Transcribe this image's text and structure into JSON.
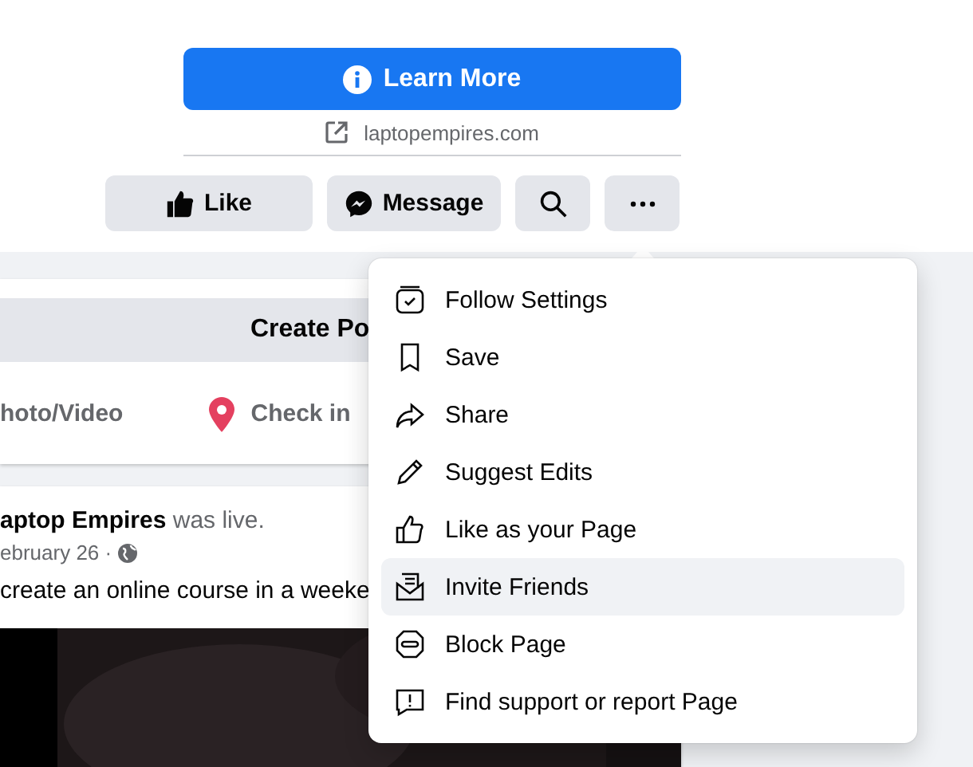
{
  "header": {
    "cta": {
      "label": "Learn More"
    },
    "website": "laptopempires.com"
  },
  "actions": [
    {
      "kind": "like",
      "label": "Like"
    },
    {
      "kind": "message",
      "label": "Message"
    },
    {
      "kind": "search"
    },
    {
      "kind": "more"
    }
  ],
  "create_post": {
    "title": "Create Po",
    "options": [
      {
        "label": "hoto/Video"
      },
      {
        "kind": "checkin",
        "label": "Check in"
      }
    ]
  },
  "post": {
    "author": "aptop Empires",
    "status": "was live.",
    "date": "ebruary 26 ·",
    "text": "create an online course in a weeke"
  },
  "menu": {
    "items": [
      {
        "label": "Follow Settings",
        "selected": false
      },
      {
        "label": "Save",
        "selected": false
      },
      {
        "label": "Share",
        "selected": false
      },
      {
        "label": "Suggest Edits",
        "selected": false
      },
      {
        "label": "Like as your Page",
        "selected": false
      },
      {
        "label": "Invite Friends",
        "selected": true
      },
      {
        "label": "Block Page",
        "selected": false
      },
      {
        "label": "Find support or report Page",
        "selected": false
      }
    ]
  }
}
